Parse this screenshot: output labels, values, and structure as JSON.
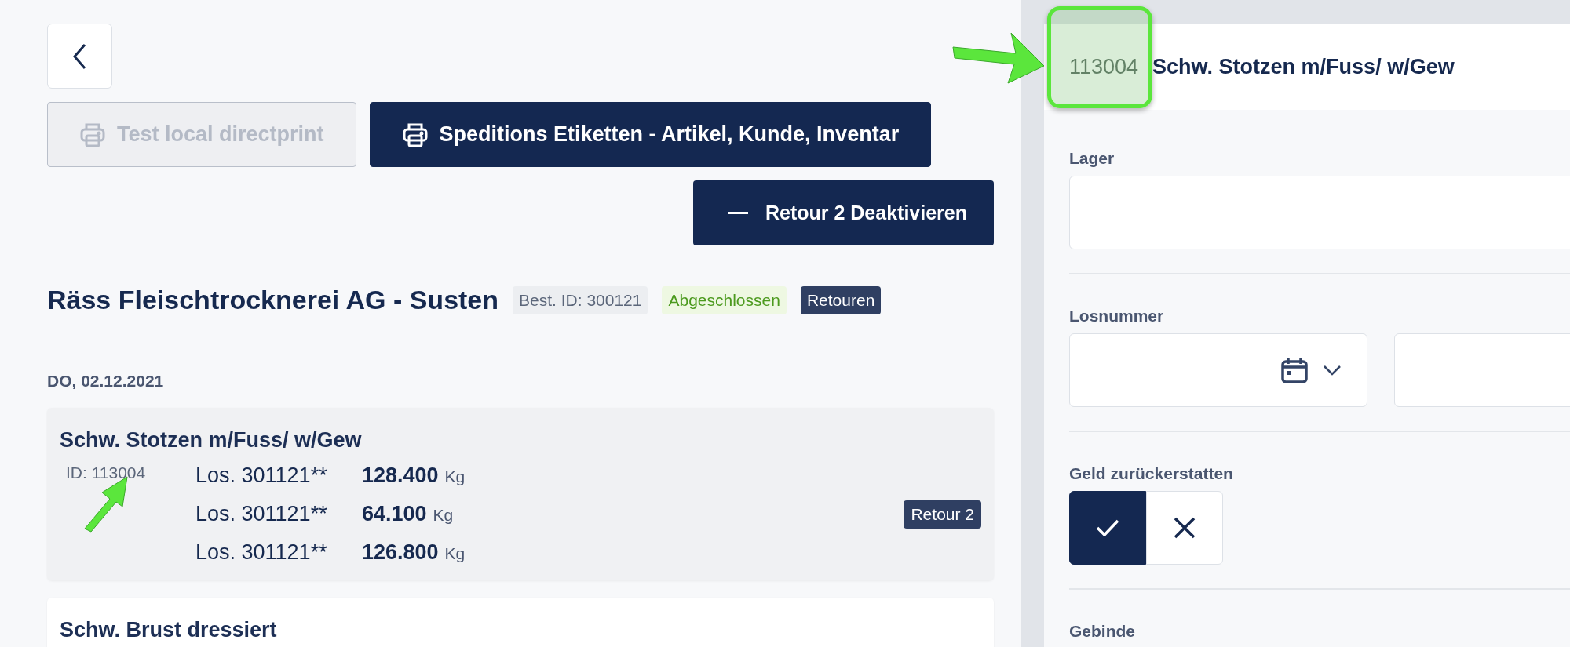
{
  "toolbar": {
    "buttons": [
      {
        "label": "Test local directprint",
        "disabled": true
      },
      {
        "label": "Speditions Etiketten - Artikel, Kunde, Inventar",
        "disabled": false
      }
    ],
    "action": {
      "label": "Retour 2 Deaktivieren"
    }
  },
  "order": {
    "customer": "Räss Fleischtrocknerei AG - Susten",
    "badges": [
      {
        "label": "Best. ID: 300121",
        "kind": "id"
      },
      {
        "label": "Abgeschlossen",
        "kind": "status"
      },
      {
        "label": "Retouren",
        "kind": "tag"
      }
    ],
    "date": "DO, 02.12.2021",
    "items": [
      {
        "name": "Schw. Stotzen m/Fuss/ w/Gew",
        "selected": true,
        "id": "ID: 113004",
        "badge": "Retour 2",
        "lots": [
          {
            "lot": "Los. 301121**",
            "amount": "128.400",
            "unit": "Kg"
          },
          {
            "lot": "Los. 301121**",
            "amount": "64.100",
            "unit": "Kg"
          },
          {
            "lot": "Los. 301121**",
            "amount": "126.800",
            "unit": "Kg"
          }
        ]
      },
      {
        "name": "Schw. Brust dressiert",
        "selected": false
      }
    ]
  },
  "detail": {
    "article_number": "113004",
    "article_name": "Schw. Stotzen m/Fuss/ w/Gew",
    "fields": [
      {
        "label": "Lager",
        "kind": "select"
      },
      {
        "label": "Losnummer",
        "kind": "lot"
      },
      {
        "label": "Geld zurückerstatten",
        "kind": "toggle",
        "on": true
      },
      {
        "label": "Gebinde",
        "kind": "label"
      }
    ]
  }
}
